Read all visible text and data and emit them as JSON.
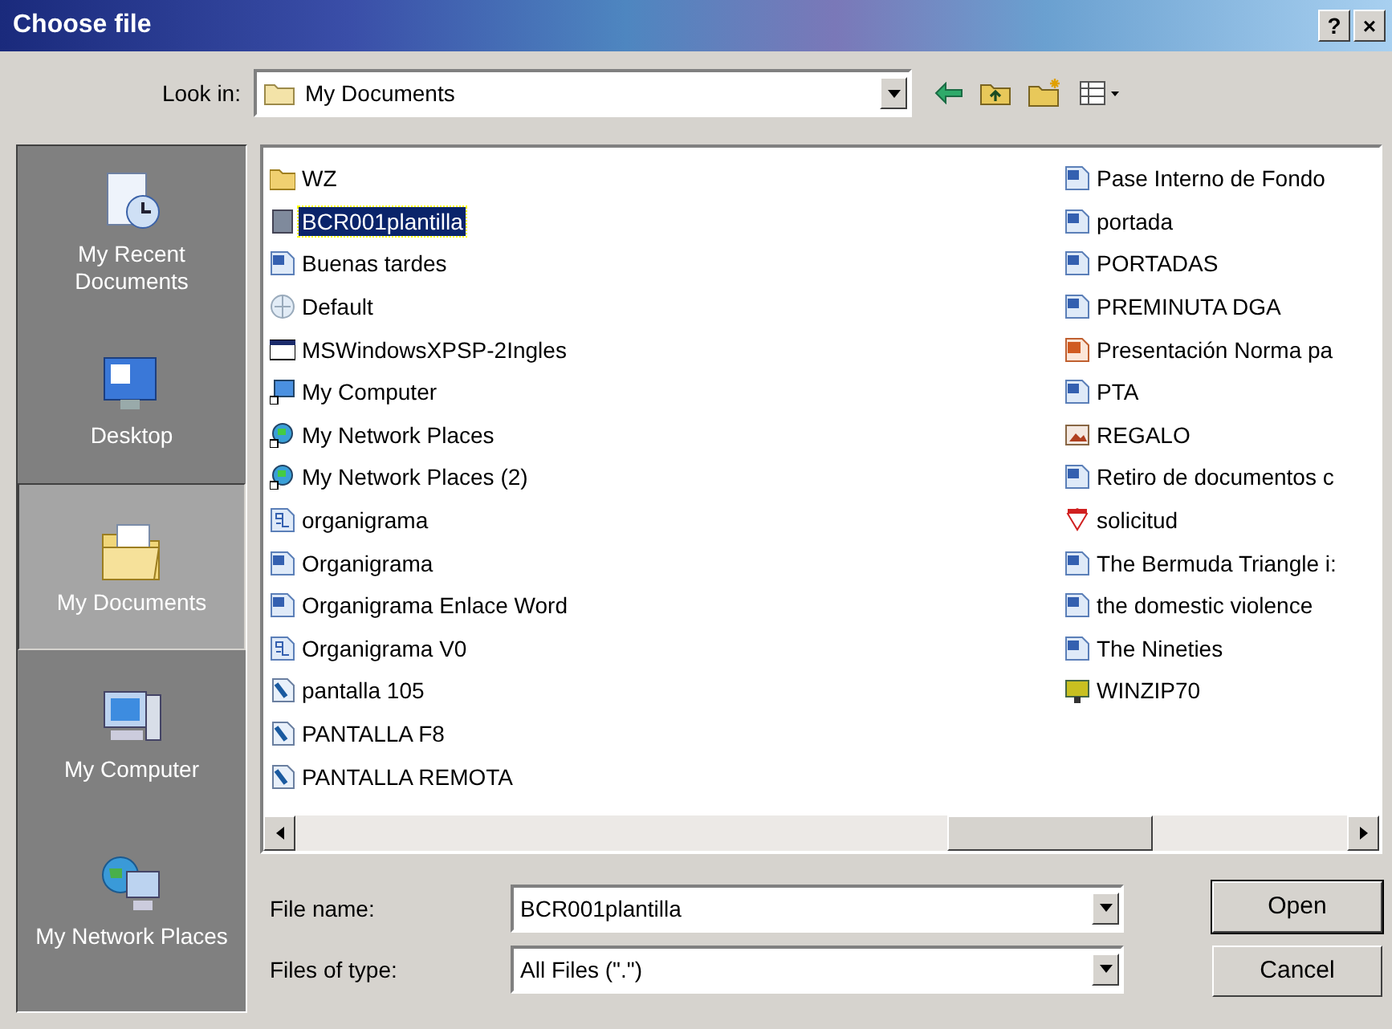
{
  "window": {
    "title": "Choose file",
    "buttons": [
      "?",
      "×"
    ]
  },
  "look_in": {
    "label": "Look in:",
    "value": "My Documents"
  },
  "sidebar": {
    "items": [
      {
        "label": "My Recent Documents",
        "kind": "recent",
        "selected": false
      },
      {
        "label": "Desktop",
        "kind": "desktop",
        "selected": false
      },
      {
        "label": "My Documents",
        "kind": "documents",
        "selected": true
      },
      {
        "label": "My Computer",
        "kind": "computer",
        "selected": false
      },
      {
        "label": "My Network Places",
        "kind": "network",
        "selected": false
      }
    ]
  },
  "files": {
    "columns": [
      [
        {
          "name": "WZ",
          "kind": "folder",
          "selected": false
        },
        {
          "name": "BCR001plantilla",
          "kind": "generic",
          "selected": true
        },
        {
          "name": "Buenas tardes",
          "kind": "word",
          "selected": false
        },
        {
          "name": "Default",
          "kind": "web",
          "selected": false
        },
        {
          "name": "MSWindowsXPSP-2Ingles",
          "kind": "window",
          "selected": false
        },
        {
          "name": "My Computer",
          "kind": "computer",
          "selected": false
        },
        {
          "name": "My Network Places",
          "kind": "network",
          "selected": false
        },
        {
          "name": "My Network Places (2)",
          "kind": "network",
          "selected": false
        },
        {
          "name": "organigrama",
          "kind": "chart",
          "selected": false
        },
        {
          "name": "Organigrama",
          "kind": "word",
          "selected": false
        },
        {
          "name": "Organigrama Enlace Word",
          "kind": "word",
          "selected": false
        },
        {
          "name": "Organigrama V0",
          "kind": "chart",
          "selected": false
        },
        {
          "name": "pantalla 105",
          "kind": "image",
          "selected": false
        },
        {
          "name": "PANTALLA F8",
          "kind": "image",
          "selected": false
        },
        {
          "name": "PANTALLA REMOTA",
          "kind": "image",
          "selected": false
        }
      ],
      [
        {
          "name": "Pase Interno de Fondo",
          "kind": "word",
          "selected": false
        },
        {
          "name": "portada",
          "kind": "word",
          "selected": false
        },
        {
          "name": "PORTADAS",
          "kind": "word",
          "selected": false
        },
        {
          "name": "PREMINUTA DGA",
          "kind": "word",
          "selected": false
        },
        {
          "name": "Presentación Norma pa",
          "kind": "slides",
          "selected": false
        },
        {
          "name": "PTA",
          "kind": "word",
          "selected": false
        },
        {
          "name": "REGALO",
          "kind": "photo",
          "selected": false
        },
        {
          "name": "Retiro de documentos c",
          "kind": "word",
          "selected": false
        },
        {
          "name": "solicitud",
          "kind": "pdf",
          "selected": false
        },
        {
          "name": "The Bermuda Triangle i:",
          "kind": "word",
          "selected": false
        },
        {
          "name": "the domestic violence",
          "kind": "word",
          "selected": false
        },
        {
          "name": "The Nineties",
          "kind": "word",
          "selected": false
        },
        {
          "name": "WINZIP70",
          "kind": "zip",
          "selected": false
        }
      ]
    ]
  },
  "file_name": {
    "label": "File name:",
    "value": "BCR001plantilla"
  },
  "file_type": {
    "label": "Files of type:",
    "value": "All Files (\".\")"
  },
  "buttons": [
    "Open",
    "Cancel"
  ]
}
